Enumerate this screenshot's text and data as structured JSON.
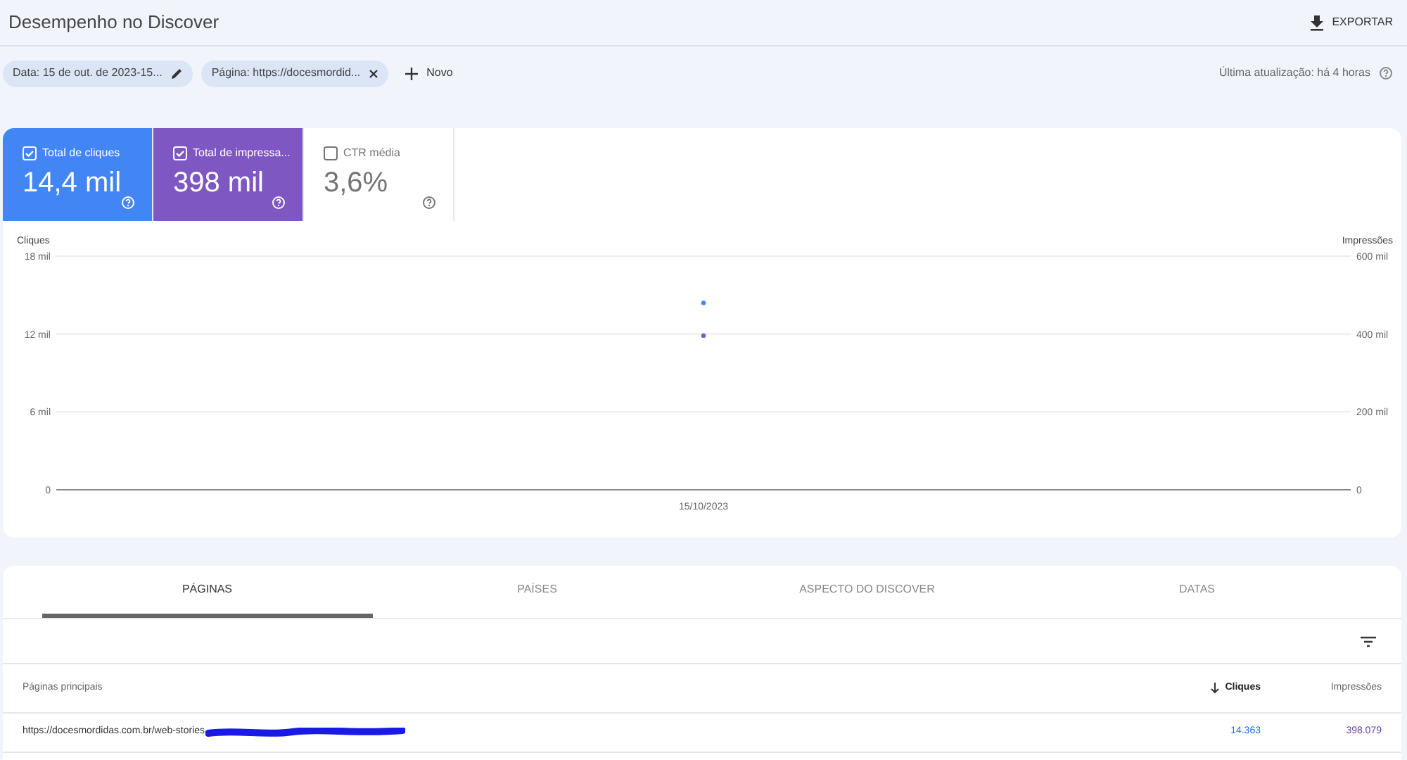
{
  "header": {
    "title": "Desempenho no Discover",
    "export_label": "EXPORTAR"
  },
  "filters": [
    {
      "kind": "edit",
      "label": "Data: 15 de out. de 2023-15..."
    },
    {
      "kind": "remove",
      "label": "Página: https://docesmordid..."
    }
  ],
  "new_filter": "Novo",
  "last_update": "Última atualização: há 4 horas",
  "metrics": [
    {
      "label": "Total de cliques",
      "value": "14,4 mil",
      "selected": true,
      "color": "#4285f4"
    },
    {
      "label": "Total de impressa...",
      "value": "398 mil",
      "selected": true,
      "color": "#7e57c2"
    },
    {
      "label": "CTR média",
      "value": "3,6%",
      "selected": false
    }
  ],
  "chart": {
    "chart_data": {
      "type": "scatter",
      "categories": [
        "15/10/2023"
      ],
      "ylim": [
        0,
        18
      ],
      "yticks": [
        {
          "value": 0,
          "label": "0"
        },
        {
          "value": 6,
          "label": "6 mil"
        },
        {
          "value": 12,
          "label": "12 mil"
        },
        {
          "value": 18,
          "label": "18 mil"
        }
      ],
      "series": [
        {
          "name": "Cliques",
          "color": "#4285f4",
          "values": [
            14.4
          ]
        }
      ]
    },
    "right_axis": {
      "name": "Impressões",
      "color": "#7e57c2",
      "ticks": [
        "600 mil",
        "400 mil",
        "200 mil",
        "0"
      ]
    }
  },
  "tabs": [
    {
      "label": "PÁGINAS",
      "selected": true
    },
    {
      "label": "PAÍSES",
      "selected": false
    },
    {
      "label": "ASPECTO DO DISCOVER",
      "selected": false
    },
    {
      "label": "DATAS",
      "selected": false
    }
  ],
  "table": {
    "columns": [
      {
        "label": "Páginas principais",
        "sorted": false
      },
      {
        "label": "Cliques",
        "sorted": true
      },
      {
        "label": "Impressões",
        "sorted": false
      }
    ],
    "rows": [
      {
        "page": "https://docesmordidas.com.br/web-stories",
        "clicks": "14.363",
        "impressions": "398.079"
      }
    ]
  }
}
